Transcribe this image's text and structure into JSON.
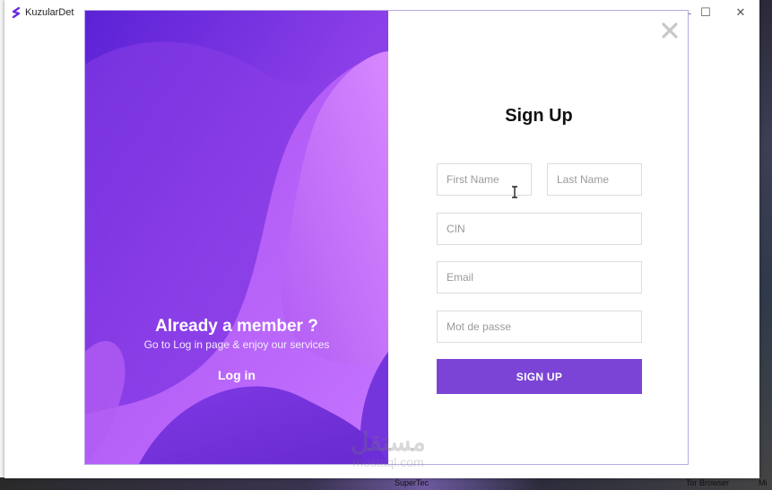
{
  "window": {
    "app_title": "KuzularDet",
    "minimize_symbol": "—",
    "maximize_symbol": "☐",
    "close_symbol": "✕",
    "logo_icon": "s-logo-icon"
  },
  "left_panel": {
    "title": "Already a member ?",
    "subtitle": "Go to Log in page & enjoy our services",
    "login_label": "Log in",
    "gradient_colors": [
      "#6a2be2",
      "#a64df0",
      "#d07cff"
    ]
  },
  "form": {
    "title": "Sign Up",
    "first_name_placeholder": "First Name",
    "last_name_placeholder": "Last Name",
    "cin_placeholder": "CIN",
    "email_placeholder": "Email",
    "password_placeholder": "Mot de passe",
    "submit_label": "SIGN UP",
    "accent_color": "#7b44d6"
  },
  "taskbar": {
    "labels": [
      "SuperTec",
      "Tor Browser",
      "Mi"
    ]
  },
  "watermark": {
    "arabic": "مستقل",
    "latin": "mostaql.com"
  }
}
